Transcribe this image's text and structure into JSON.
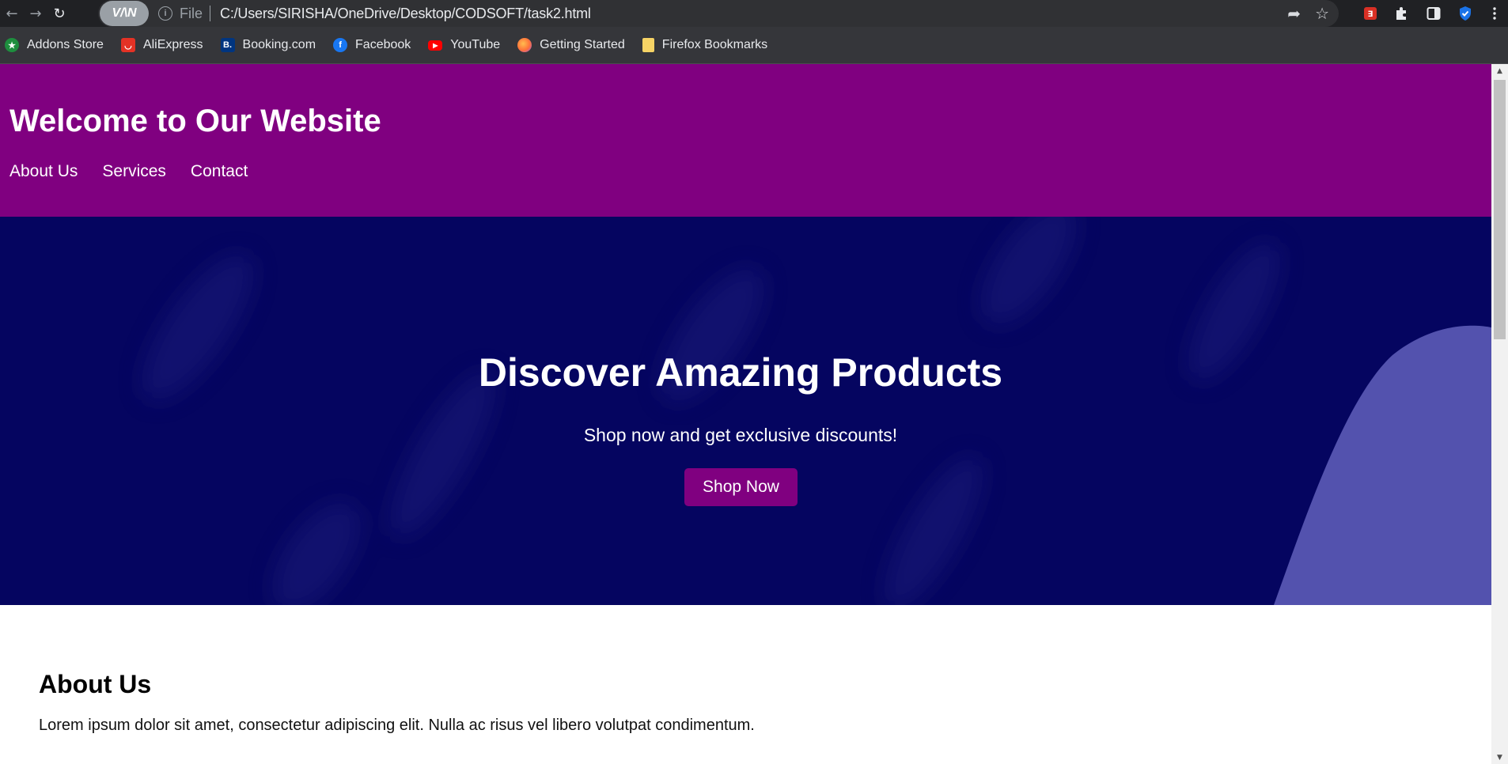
{
  "browser": {
    "vpn_label": "V/\\N",
    "scheme_label": "File",
    "url": "C:/Users/SIRISHA/OneDrive/Desktop/CODSOFT/task2.html",
    "nav_icons": [
      "back-arrow-icon",
      "forward-arrow-icon",
      "reload-icon"
    ],
    "omnibox_icons": [
      "share-icon",
      "bookmark-star-icon"
    ],
    "extension_icons": [
      "pdf-extension-icon",
      "puzzle-extensions-icon",
      "side-panel-icon",
      "shield-extension-icon",
      "kebab-menu-icon"
    ],
    "bookmarks": [
      {
        "label": "Addons Store",
        "icon": "addons-store-icon",
        "color": "#1e8e3e"
      },
      {
        "label": "AliExpress",
        "icon": "aliexpress-icon",
        "color": "#e43225"
      },
      {
        "label": "Booking.com",
        "icon": "booking-icon",
        "color": "#003580"
      },
      {
        "label": "Facebook",
        "icon": "facebook-icon",
        "color": "#1877f2"
      },
      {
        "label": "YouTube",
        "icon": "youtube-icon",
        "color": "#ff0000"
      },
      {
        "label": "Getting Started",
        "icon": "firefox-icon",
        "color": "#ff7139"
      },
      {
        "label": "Firefox Bookmarks",
        "icon": "folder-icon",
        "color": "#f6d365"
      }
    ]
  },
  "page": {
    "header": {
      "title": "Welcome to Our Website",
      "nav": [
        "About Us",
        "Services",
        "Contact"
      ],
      "background": "#800080"
    },
    "hero": {
      "title": "Discover Amazing Products",
      "subtitle": "Shop now and get exclusive discounts!",
      "cta_label": "Shop Now",
      "background": "#050560",
      "cta_color": "#800080"
    },
    "about": {
      "title": "About Us",
      "text": "Lorem ipsum dolor sit amet, consectetur adipiscing elit. Nulla ac risus vel libero volutpat condimentum."
    }
  }
}
